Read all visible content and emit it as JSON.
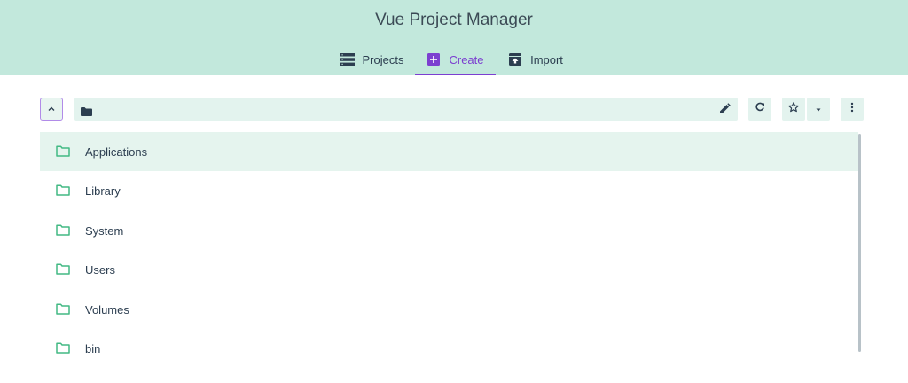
{
  "app": {
    "title": "Vue Project Manager"
  },
  "tabs": [
    {
      "label": "Projects",
      "icon": "list-icon",
      "active": false
    },
    {
      "label": "Create",
      "icon": "add-box-icon",
      "active": true
    },
    {
      "label": "Import",
      "icon": "unarchive-icon",
      "active": false
    }
  ],
  "toolbar": {
    "current_path": "",
    "actions": [
      "folder-up-icon",
      "edit-icon",
      "refresh-icon",
      "star-icon",
      "dropdown-icon",
      "more-vert-icon"
    ]
  },
  "folders": [
    {
      "name": "Applications",
      "selected": true
    },
    {
      "name": "Library",
      "selected": false
    },
    {
      "name": "System",
      "selected": false
    },
    {
      "name": "Users",
      "selected": false
    },
    {
      "name": "Volumes",
      "selected": false
    },
    {
      "name": "bin",
      "selected": false
    }
  ],
  "colors": {
    "header_bg": "#c2e8dc",
    "accent": "#7c3fd0",
    "folder_green": "#42b983",
    "selected_row": "#e5f4ee"
  }
}
